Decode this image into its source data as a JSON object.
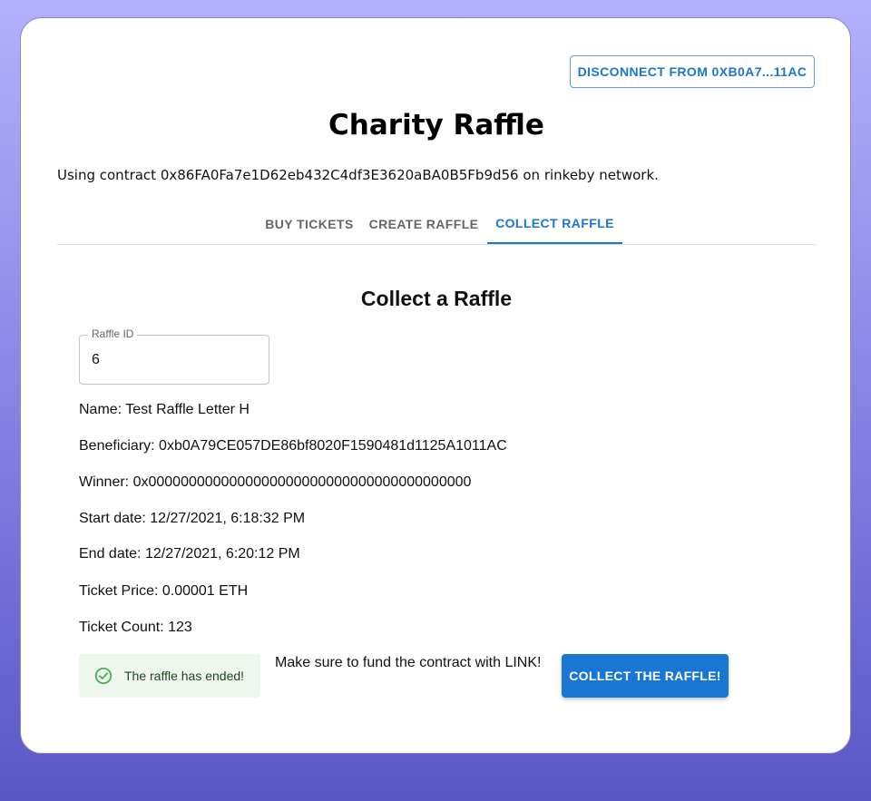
{
  "header": {
    "disconnect_label": "DISCONNECT FROM 0XB0A7...11AC"
  },
  "page": {
    "title": "Charity Raffle",
    "contract_info": "Using contract 0x86FA0Fa7e1D62eb432C4df3E3620aBA0B5Fb9d56 on rinkeby network."
  },
  "tabs": [
    {
      "label": "BUY TICKETS",
      "active": false
    },
    {
      "label": "CREATE RAFFLE",
      "active": false
    },
    {
      "label": "COLLECT RAFFLE",
      "active": true
    }
  ],
  "collect": {
    "section_title": "Collect a Raffle",
    "raffle_id_label": "Raffle ID",
    "raffle_id_value": "6",
    "name": "Name: Test Raffle Letter H",
    "beneficiary": "Beneficiary: 0xb0A79CE057DE86bf8020F1590481d1125A1011AC",
    "winner": "Winner: 0x0000000000000000000000000000000000000000",
    "start_date": "Start date: 12/27/2021, 6:18:32 PM",
    "end_date": "End date: 12/27/2021, 6:20:12 PM",
    "ticket_price": "Ticket Price: 0.00001 ETH",
    "ticket_count": "Ticket Count: 123",
    "status_alert": "The raffle has ended!",
    "fund_note": "Make sure to fund the contract with LINK!",
    "collect_button": "COLLECT THE RAFFLE!"
  },
  "icons": {
    "alert": "check-circle-outline-icon"
  },
  "colors": {
    "primary": "#1976d2",
    "success_bg": "#edf7ed",
    "success_icon": "#4caf50"
  }
}
